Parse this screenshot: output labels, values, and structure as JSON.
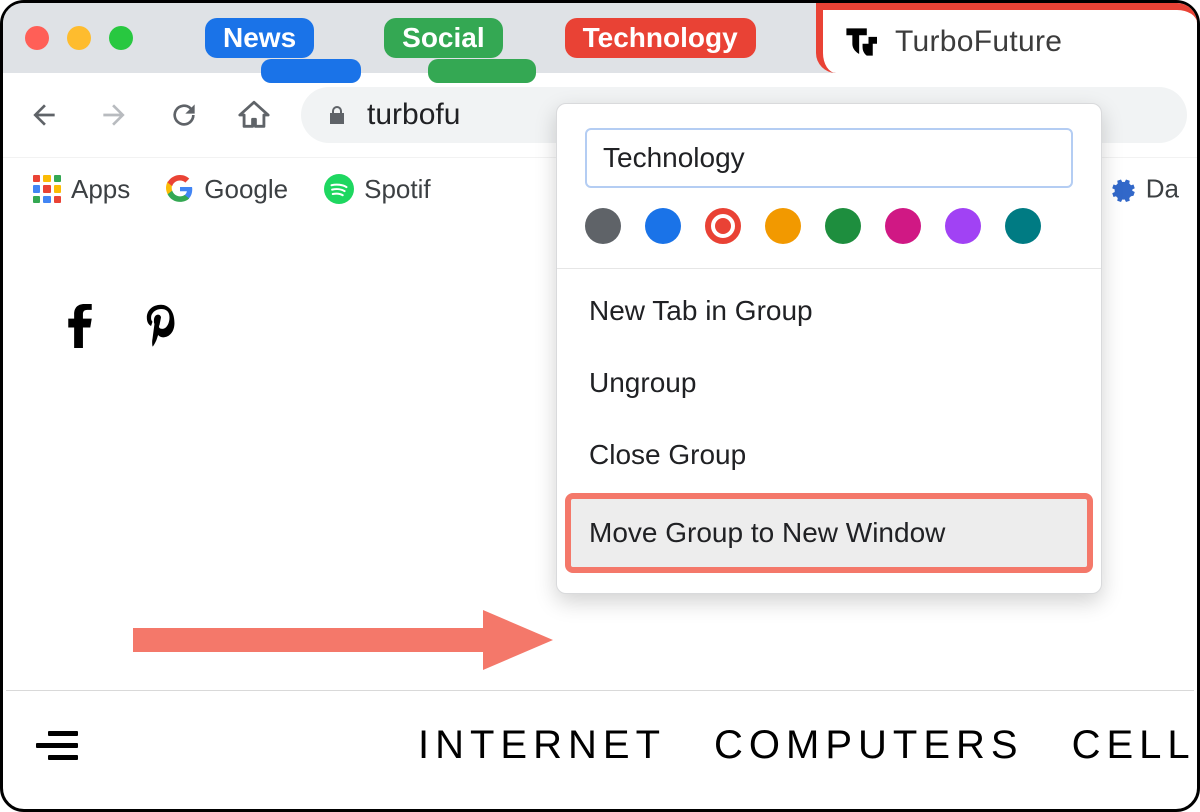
{
  "tab_groups": [
    {
      "label": "News",
      "color": "#1a73e8"
    },
    {
      "label": "Social",
      "color": "#34a853"
    },
    {
      "label": "Technology",
      "color": "#e94235"
    }
  ],
  "active_tab": {
    "title": "TurboFuture",
    "group_accent": "#e94235"
  },
  "toolbar": {
    "url_display": "turbofu"
  },
  "bookmarks": {
    "apps_label": "Apps",
    "google_label": "Google",
    "spotify_label": "Spotif",
    "ext_label": "Da"
  },
  "group_menu": {
    "name_value": "Technology",
    "colors": [
      {
        "name": "grey",
        "hex": "#5f6368",
        "selected": false
      },
      {
        "name": "blue",
        "hex": "#1a73e8",
        "selected": false
      },
      {
        "name": "red",
        "hex": "#e94235",
        "selected": true
      },
      {
        "name": "orange",
        "hex": "#f29900",
        "selected": false
      },
      {
        "name": "green",
        "hex": "#1e8e3e",
        "selected": false
      },
      {
        "name": "pink",
        "hex": "#d01884",
        "selected": false
      },
      {
        "name": "purple",
        "hex": "#a142f4",
        "selected": false
      },
      {
        "name": "cyan",
        "hex": "#007b83",
        "selected": false
      }
    ],
    "items": {
      "new_tab": "New Tab in Group",
      "ungroup": "Ungroup",
      "close": "Close Group",
      "move_new": "Move Group to New Window"
    }
  },
  "site_nav": {
    "links": [
      "INTERNET",
      "COMPUTERS",
      "CELL"
    ]
  }
}
